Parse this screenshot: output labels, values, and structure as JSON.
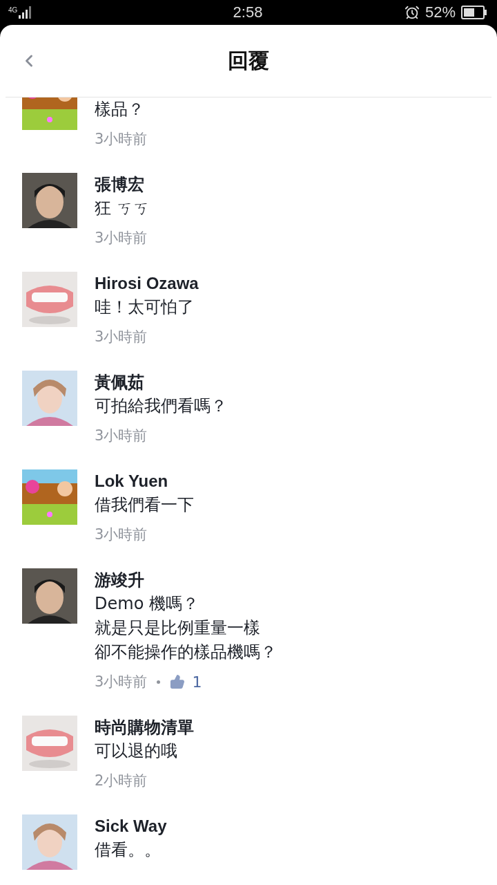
{
  "status_bar": {
    "network": "4G",
    "time": "2:58",
    "battery": "52%"
  },
  "header": {
    "title": "回覆"
  },
  "comments": [
    {
      "body": [
        "樣品？"
      ],
      "time": "3小時前"
    },
    {
      "name": "張博宏",
      "body": [
        "狂 ㄎㄎ"
      ],
      "time": "3小時前"
    },
    {
      "name": "Hirosi Ozawa",
      "body": [
        "哇！太可怕了"
      ],
      "time": "3小時前"
    },
    {
      "name": "黃佩茹",
      "body": [
        "可拍給我們看嗎？"
      ],
      "time": "3小時前"
    },
    {
      "name": "Lok Yuen",
      "body": [
        "借我們看一下"
      ],
      "time": "3小時前"
    },
    {
      "name": "游竣升",
      "body": [
        "Demo 機嗎？",
        "就是只是比例重量一樣",
        "卻不能操作的樣品機嗎？"
      ],
      "time": "3小時前",
      "likes": "1"
    },
    {
      "name": "時尚購物清單",
      "body": [
        "可以退的哦"
      ],
      "time": "2小時前"
    },
    {
      "name": "Sick Way",
      "body": [
        "借看。。"
      ]
    }
  ]
}
